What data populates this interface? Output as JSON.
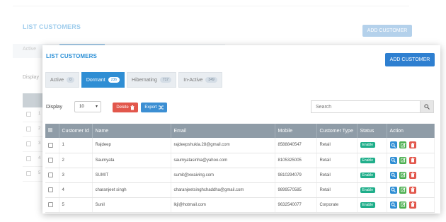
{
  "background": {
    "title": "LIST CUSTOMERS",
    "add_button": "ADD CUSTOMER",
    "tab_active": "Active",
    "display_label": "Display",
    "row_numbers": [
      "1",
      "2",
      "3",
      "4",
      "5"
    ]
  },
  "card": {
    "title": "LIST CUSTOMERS",
    "add_button": "ADD CUSTOMER",
    "tabs": [
      {
        "label": "Active",
        "count": "0"
      },
      {
        "label": "Dormant",
        "count": "236"
      },
      {
        "label": "Hibernating",
        "count": "717"
      },
      {
        "label": "In-Active",
        "count": "349"
      }
    ],
    "active_tab": "Dormant",
    "display_label": "Display",
    "display_value": "10",
    "delete_button": "Delete",
    "export_button": "Export",
    "search_placeholder": "Search",
    "table": {
      "headers": [
        "",
        "Customer Id",
        "Name",
        "Email",
        "Mobile",
        "Customer Type",
        "Status",
        "Action"
      ],
      "rows": [
        {
          "id": "1",
          "name": "Rajdeep",
          "email": "rajdeepshukla.28@gmail.com",
          "mobile": "8588840547",
          "type": "Retail",
          "status": "Enable"
        },
        {
          "id": "2",
          "name": "Saumyata",
          "email": "saumyatasinha@yahoo.com",
          "mobile": "8105325005",
          "type": "Retail",
          "status": "Enable"
        },
        {
          "id": "3",
          "name": "SUMIT",
          "email": "sumit@xwaiving.com",
          "mobile": "9810294079",
          "type": "Retail",
          "status": "Enable"
        },
        {
          "id": "4",
          "name": "charanjeet singh",
          "email": "charanjeetsinghchaddha@gmail.com",
          "mobile": "9899570585",
          "type": "Retail",
          "status": "Enable"
        },
        {
          "id": "5",
          "name": "Sunil",
          "email": "lkjl@hotmail.com",
          "mobile": "9632540077",
          "type": "Corporate",
          "status": "Enable"
        }
      ]
    }
  },
  "colors": {
    "accent": "#2f8ed4",
    "title_blue": "#2a8fd6",
    "header_gray": "#8f9ca7",
    "status_green": "#1fae8a",
    "delete_red": "#e2574c",
    "edit_green": "#4caf50"
  },
  "icons": {
    "select_all": "list-icon",
    "delete": "trash-icon",
    "export": "shuffle-icon",
    "search": "search-icon",
    "view": "zoom-icon",
    "edit": "edit-icon",
    "remove": "trash-icon"
  }
}
